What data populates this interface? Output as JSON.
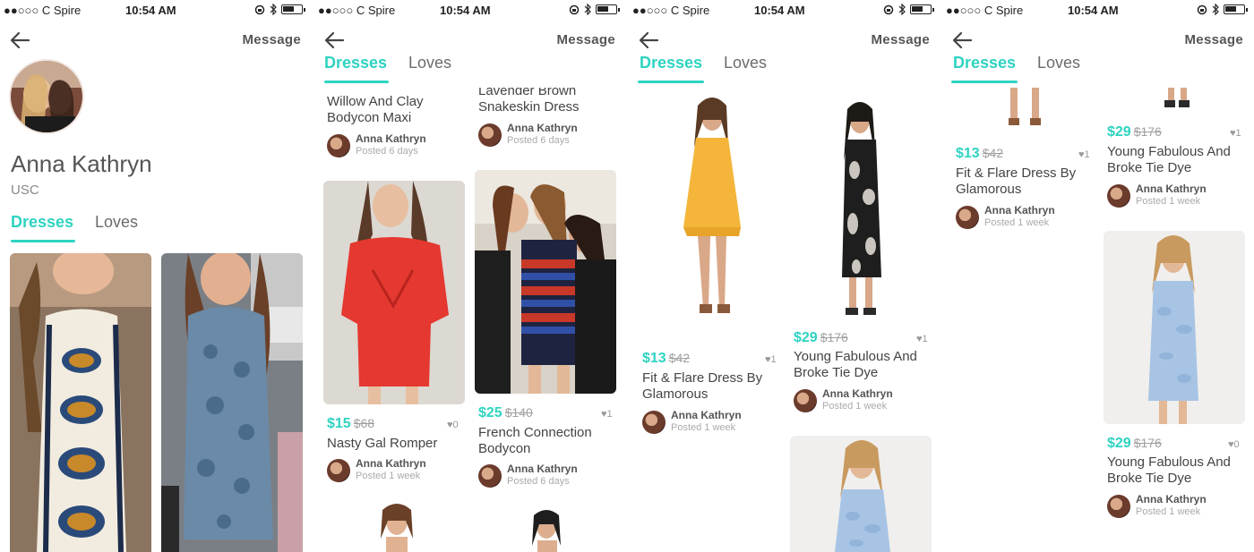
{
  "status_bar": {
    "carrier": "●●○○○ C Spire",
    "time": "10:54 AM"
  },
  "nav": {
    "message": "Message"
  },
  "tabs": {
    "dresses": "Dresses",
    "loves": "Loves"
  },
  "profile": {
    "name": "Anna Kathryn",
    "school": "USC"
  },
  "screen2": {
    "top_left": {
      "title_line1": "Willow And Clay",
      "title_line2": "Bodycon Maxi",
      "poster": "Anna Kathryn",
      "posted": "Posted 6 days"
    },
    "top_right": {
      "title_line1": "Lavender Brown",
      "title_line2": "Snakeskin Dress",
      "poster": "Anna Kathryn",
      "posted": "Posted 6 days"
    },
    "mid_left": {
      "price": "$15",
      "old_price": "$68",
      "likes": "♥0",
      "title_line1": "Nasty Gal Romper",
      "title_line2": "",
      "poster": "Anna Kathryn",
      "posted": "Posted 1 week"
    },
    "mid_right": {
      "price": "$25",
      "old_price": "$140",
      "likes": "♥1",
      "title_line1": "French Connection",
      "title_line2": "Bodycon",
      "poster": "Anna Kathryn",
      "posted": "Posted 6 days"
    }
  },
  "screen3": {
    "left": {
      "price": "$13",
      "old_price": "$42",
      "likes": "♥1",
      "title_line1": "Fit & Flare Dress By",
      "title_line2": "Glamorous",
      "poster": "Anna Kathryn",
      "posted": "Posted 1 week"
    },
    "right": {
      "price": "$29",
      "old_price": "$176",
      "likes": "♥1",
      "title_line1": "Young Fabulous And",
      "title_line2": "Broke Tie Dye",
      "poster": "Anna Kathryn",
      "posted": "Posted 1 week"
    }
  },
  "screen4": {
    "left": {
      "price": "$13",
      "old_price": "$42",
      "likes": "♥1",
      "title_line1": "Fit & Flare Dress By",
      "title_line2": "Glamorous",
      "poster": "Anna Kathryn",
      "posted": "Posted 1 week"
    },
    "right_top": {
      "price": "$29",
      "old_price": "$176",
      "likes": "♥1",
      "title_line1": "Young Fabulous And",
      "title_line2": "Broke Tie Dye",
      "poster": "Anna Kathryn",
      "posted": "Posted 1 week"
    },
    "right_bottom": {
      "price": "$29",
      "old_price": "$176",
      "likes": "♥0",
      "title_line1": "Young Fabulous And",
      "title_line2": "Broke Tie Dye",
      "poster": "Anna Kathryn",
      "posted": "Posted 1 week"
    }
  },
  "colors": {
    "accent": "#2ed3c1",
    "text": "#4a4a4a",
    "muted": "#a0a0a0"
  },
  "icons": {
    "back": "arrow-left-icon",
    "wifi": "wifi-icon",
    "bluetooth": "bluetooth-icon",
    "battery": "battery-icon",
    "heart": "heart-icon"
  }
}
